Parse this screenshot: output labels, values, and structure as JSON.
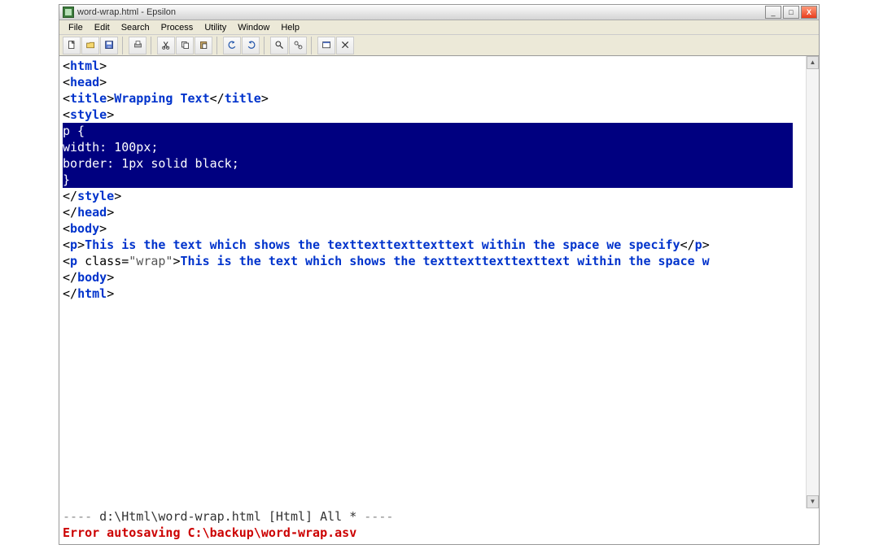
{
  "window": {
    "title": "word-wrap.html - Epsilon"
  },
  "menu": {
    "items": [
      "File",
      "Edit",
      "Search",
      "Process",
      "Utility",
      "Window",
      "Help"
    ]
  },
  "toolbar": {
    "buttons": [
      {
        "name": "new-file-icon",
        "glyph": "new"
      },
      {
        "name": "open-file-icon",
        "glyph": "open"
      },
      {
        "name": "save-file-icon",
        "glyph": "save"
      },
      {
        "name": "sep"
      },
      {
        "name": "print-icon",
        "glyph": "print"
      },
      {
        "name": "sep"
      },
      {
        "name": "cut-icon",
        "glyph": "cut"
      },
      {
        "name": "copy-icon",
        "glyph": "copy"
      },
      {
        "name": "paste-icon",
        "glyph": "paste"
      },
      {
        "name": "sep"
      },
      {
        "name": "undo-icon",
        "glyph": "undo"
      },
      {
        "name": "redo-icon",
        "glyph": "redo"
      },
      {
        "name": "sep"
      },
      {
        "name": "find-icon",
        "glyph": "find"
      },
      {
        "name": "find-replace-icon",
        "glyph": "findrep"
      },
      {
        "name": "sep"
      },
      {
        "name": "window-icon",
        "glyph": "win"
      },
      {
        "name": "close-doc-icon",
        "glyph": "x"
      }
    ]
  },
  "code": {
    "line1_tag": "html",
    "line2_tag": "head",
    "line3_open": "title",
    "line3_text": "Wrapping Text",
    "line3_close": "title",
    "line4_tag": "style",
    "sel_line1": "p {",
    "sel_line2": "width: 100px;",
    "sel_line3": "border: 1px solid black;",
    "sel_line4": "}",
    "line_closestyle": "style",
    "line_closehead": "head",
    "line_body": "body",
    "line_p_open": "p",
    "line_p_text": "This is the text which shows the texttexttexttexttext within the space we specify",
    "line_p_close": "p",
    "line_p2_open": "p",
    "line_p2_attr": " class=",
    "line_p2_val": "\"wrap\"",
    "line_p2_text": "This is the text which shows the texttexttexttexttext within the space w",
    "line_closebody": "body",
    "line_closehtml": "html"
  },
  "status": {
    "dashes_left": "----",
    "path": " d:\\Html\\word-wrap.html [Html] All * ",
    "dashes_right": "----",
    "error": "Error autosaving C:\\backup\\word-wrap.asv"
  }
}
